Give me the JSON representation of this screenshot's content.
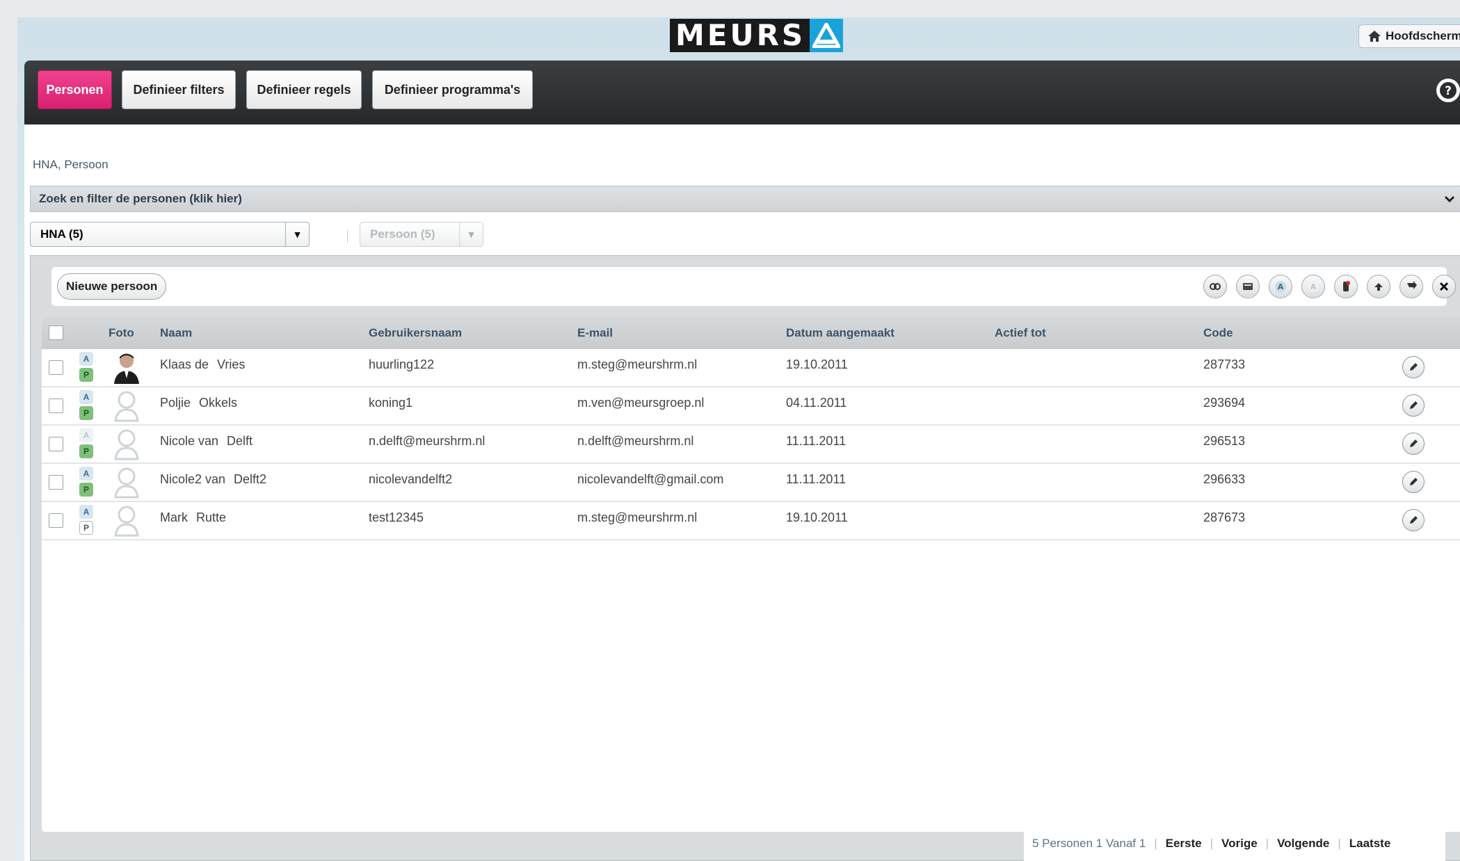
{
  "logo": {
    "text": "MEURS"
  },
  "home_button": {
    "label": "Hoofdscherm"
  },
  "nav": {
    "tabs": [
      {
        "label": "Personen",
        "active": true
      },
      {
        "label": "Definieer filters",
        "active": false
      },
      {
        "label": "Definieer regels",
        "active": false
      },
      {
        "label": "Definieer programma's",
        "active": false
      }
    ]
  },
  "breadcrumb": "HNA, Persoon",
  "filter_bar": {
    "label": "Zoek en filter de personen (klik hier)"
  },
  "selects": {
    "organization": {
      "value": "HNA (5)"
    },
    "type": {
      "value": "Persoon (5)",
      "disabled": true
    }
  },
  "toolbar": {
    "new_person_label": "Nieuwe persoon",
    "tools": [
      "link-icon",
      "card-icon",
      "activate-icon",
      "deactivate-icon",
      "mobile-icon",
      "import-icon",
      "export-icon",
      "delete-icon"
    ]
  },
  "table": {
    "headers": {
      "photo": "Foto",
      "name": "Naam",
      "username": "Gebruikersnaam",
      "email": "E-mail",
      "created": "Datum aangemaakt",
      "active_until": "Actief tot",
      "code": "Code"
    },
    "rows": [
      {
        "a": "A",
        "p": "P",
        "a_on": true,
        "p_on": true,
        "photo": "person-photo",
        "first": "Klaas de",
        "last": "Vries",
        "username": "huurling122",
        "email": "m.steg@meurshrm.nl",
        "created": "19.10.2011",
        "active_until": "",
        "code": "287733"
      },
      {
        "a": "A",
        "p": "P",
        "a_on": true,
        "p_on": true,
        "photo": "placeholder",
        "first": "Poljie",
        "last": "Okkels",
        "username": "koning1",
        "email": "m.ven@meursgroep.nl",
        "created": "04.11.2011",
        "active_until": "",
        "code": "293694"
      },
      {
        "a": "A",
        "p": "P",
        "a_on": false,
        "p_on": true,
        "photo": "placeholder",
        "first": "Nicole van",
        "last": "Delft",
        "username": "n.delft@meurshrm.nl",
        "email": "n.delft@meurshrm.nl",
        "created": "11.11.2011",
        "active_until": "",
        "code": "296513"
      },
      {
        "a": "A",
        "p": "P",
        "a_on": true,
        "p_on": true,
        "photo": "placeholder",
        "first": "Nicole2 van",
        "last": "Delft2",
        "username": "nicolevandelft2",
        "email": "nicolevandelft@gmail.com",
        "created": "11.11.2011",
        "active_until": "",
        "code": "296633"
      },
      {
        "a": "A",
        "p": "P",
        "a_on": true,
        "p_on": false,
        "photo": "placeholder",
        "first": "Mark",
        "last": "Rutte",
        "username": "test12345",
        "email": "m.steg@meurshrm.nl",
        "created": "19.10.2011",
        "active_until": "",
        "code": "287673"
      }
    ]
  },
  "pager": {
    "summary": "5 Personen 1 Vanaf 1",
    "first": "Eerste",
    "prev": "Vorige",
    "next": "Volgende",
    "last": "Laatste"
  },
  "colors": {
    "accent": "#e0287a",
    "nav_bg": "#2c3033",
    "header_text": "#3d5366"
  }
}
